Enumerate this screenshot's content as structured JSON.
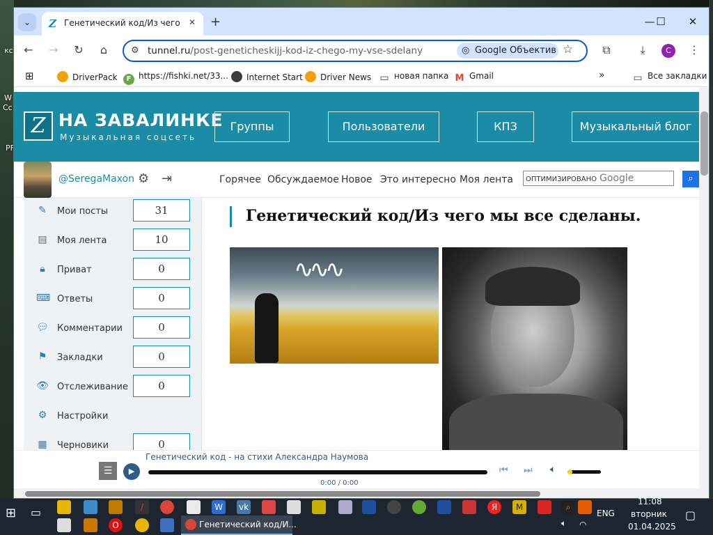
{
  "desktop": {
    "edge_fragments": [
      "кс",
      "W",
      "Cc",
      "PF"
    ]
  },
  "browser": {
    "tab": {
      "title": "Генетический код/Из чего мы все сделаны."
    },
    "url_host": "tunnel.ru",
    "url_path": "/post-geneticheskijj-kod-iz-chego-my-vse-sdelany",
    "lens_label": "Google Объектив",
    "profile_initial": "C",
    "bookmarks": [
      {
        "label": "DriverPack",
        "color": "#f4a100"
      },
      {
        "label": "https://fishki.net/33...",
        "color": "#6aa843"
      },
      {
        "label": "Internet Start",
        "color": "#3d3d3d"
      },
      {
        "label": "Driver News",
        "color": "#f4a100"
      },
      {
        "label": "новая папка",
        "color": "#444444"
      },
      {
        "label": "Gmail",
        "color": "#ea4335"
      }
    ],
    "all_bookmarks": "Все закладки"
  },
  "site": {
    "logo_title": "НА ЗАВАЛИНКЕ",
    "logo_subtitle": "Музыкальная соцсеть",
    "nav": [
      "Группы",
      "Пользователи",
      "КПЗ",
      "Музыкальный блог"
    ],
    "username": "@SeregaMaxon",
    "subnav": [
      "Горячее",
      "Обсуждаемое",
      "Новое",
      "Это интересно",
      "Моя лента"
    ],
    "search_label": "ОПТИМИЗИРОВАНО",
    "search_brand": "Google",
    "accent": "#1a8ca5"
  },
  "sidebar": {
    "items": [
      {
        "label": "Мои посты",
        "count": "31"
      },
      {
        "label": "Моя лента",
        "count": "10"
      },
      {
        "label": "Приват",
        "count": "0"
      },
      {
        "label": "Ответы",
        "count": "0"
      },
      {
        "label": "Комментарии",
        "count": "0"
      },
      {
        "label": "Закладки",
        "count": "0"
      },
      {
        "label": "Отслеживание",
        "count": "0"
      },
      {
        "label": "Настройки",
        "count": ""
      },
      {
        "label": "Черновики",
        "count": "0"
      }
    ]
  },
  "post": {
    "title": "Генетический код/Из чего мы все сделаны."
  },
  "player": {
    "track": "Генетический код - на стихи Александра Наумова",
    "time": "0:00 / 0:00"
  },
  "taskbar": {
    "active_window": "Генетический код/И...",
    "lang": "ENG",
    "time": "11:08",
    "day": "вторник",
    "date": "01.04.2025"
  }
}
